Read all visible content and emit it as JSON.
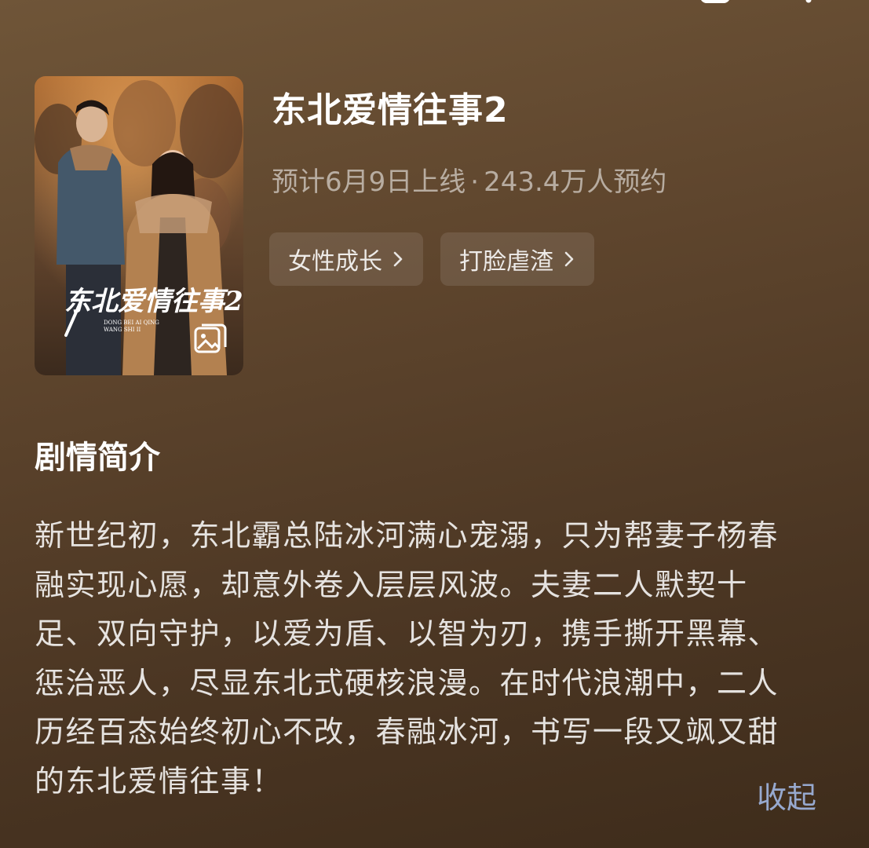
{
  "nav": {
    "back_icon": "back-chevron-icon",
    "share_icon": "share-icon",
    "more_icon": "more-icon"
  },
  "show": {
    "title": "东北爱情往事2",
    "release_info": "预计6月9日上线",
    "separator": "·",
    "reservations": "243.4万人预约",
    "poster_icon": "gallery-icon"
  },
  "tags": [
    {
      "label": "女性成长"
    },
    {
      "label": "打脸虐渣"
    }
  ],
  "synopsis": {
    "heading": "剧情简介",
    "text": "新世纪初，东北霸总陆冰河满心宠溺，只为帮妻子杨春\n融实现心愿，却意外卷入层层风波。夫妻二人默契十\n足、双向守护，以爱为盾、以智为刃，携手撕开黑幕、\n惩治恶人，尽显东北式硬核浪漫。在时代浪潮中，二人\n历经百态始终初心不改，春融冰河，书写一段又飒又甜\n的东北爱情往事！",
    "collapse_label": "收起"
  },
  "colors": {
    "background_top": "#6f5538",
    "background_bottom": "#3e2c1b",
    "link": "#97a9cf"
  }
}
